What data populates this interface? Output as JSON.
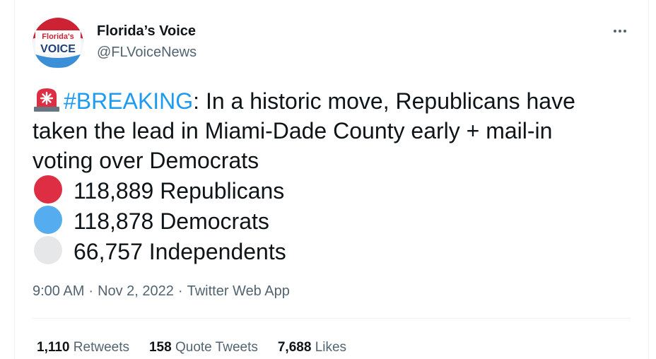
{
  "tweet": {
    "author": {
      "display_name": "Florida’s Voice",
      "handle": "@FLVoiceNews",
      "avatar_text_top": "Florida's",
      "avatar_text_bottom": "VOICE"
    },
    "more_icon": "more-horizontal-icon",
    "text": {
      "hashtag": "#BREAKING",
      "line1_rest": ": In a historic move, Republicans have",
      "line2": "taken the lead in Miami-Dade County early + mail-in",
      "line3": "voting over Democrats",
      "results": [
        {
          "color_icon": "red-circle-icon",
          "color": "#dd2e44",
          "text": "118,889 Republicans"
        },
        {
          "color_icon": "blue-circle-icon",
          "color": "#55acee",
          "text": "118,878 Democrats"
        },
        {
          "color_icon": "white-circle-icon",
          "color": "#e6e7e8",
          "text": "66,757 Independents"
        }
      ]
    },
    "time": "9:00 AM",
    "date": "Nov 2, 2022",
    "source": "Twitter Web App",
    "separator": "·",
    "stats": {
      "retweets_count": "1,110",
      "retweets_label": "Retweets",
      "quotes_count": "158",
      "quotes_label": "Quote Tweets",
      "likes_count": "7,688",
      "likes_label": "Likes"
    }
  },
  "colors": {
    "accent": "#1d9bf0",
    "secondary_text": "#536471",
    "primary_text": "#0f1419"
  }
}
